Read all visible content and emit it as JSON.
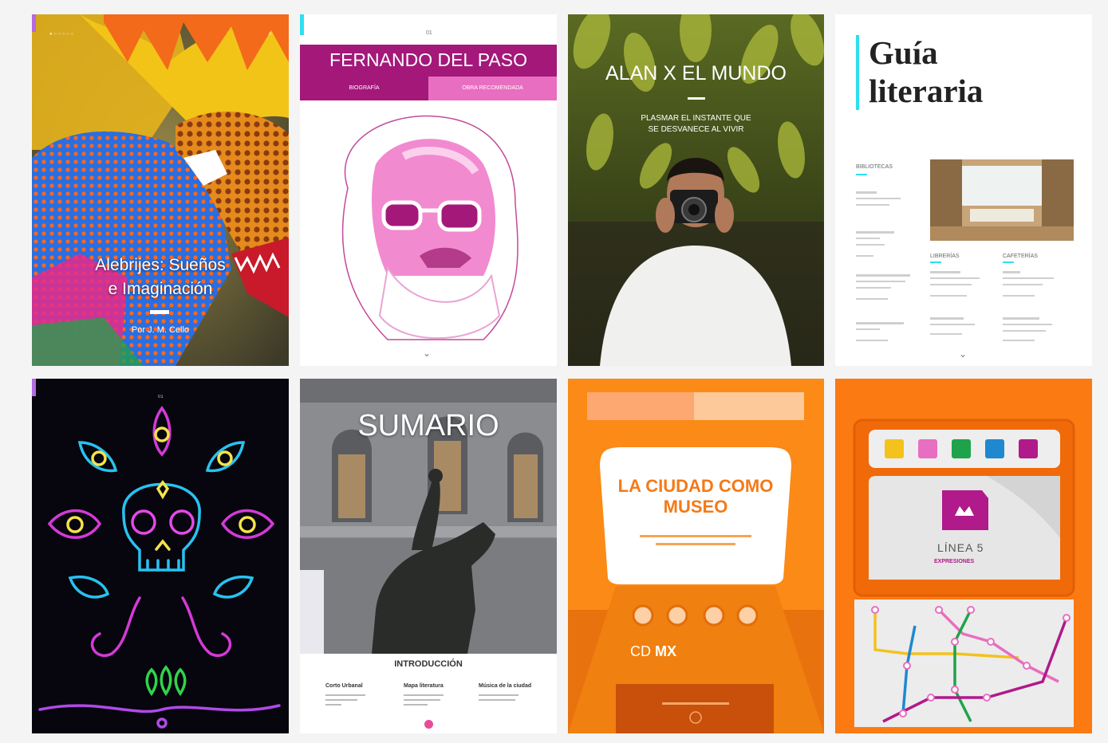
{
  "colors": {
    "page_bg": "#f4f4f4",
    "magenta": "#a4187a",
    "pink": "#e86ec1",
    "orange": "#fb8a16",
    "cyan": "#2de0f0"
  },
  "cards": {
    "alebrijes": {
      "title_line1": "Alebrijes: Sueños",
      "title_line2": "e Imaginación",
      "byline": "Por J. M. Cello"
    },
    "fernando": {
      "title": "FERNANDO DEL PASO",
      "tab_left": "BIOGRAFÍA",
      "tab_right": "OBRA RECOMENDADA",
      "page": "01",
      "icons": [
        "chevron-down-icon"
      ]
    },
    "alan": {
      "title": "ALAN X EL MUNDO",
      "subtitle_line1": "PLASMAR EL INSTANTE QUE",
      "subtitle_line2": "SE DESVANECE AL VIVIR"
    },
    "guia": {
      "title_line1": "Guía",
      "title_line2": "literaria",
      "sections": [
        "BIBLIOTECAS",
        "LIBRERÍAS",
        "CAFETERÍAS"
      ]
    },
    "neon": {
      "page": "01"
    },
    "sumario": {
      "title": "SUMARIO",
      "section": "INTRODUCCIÓN",
      "columns": [
        "Corto Urbanal",
        "Mapa literatura",
        "Música de la ciudad"
      ]
    },
    "ciudad": {
      "title_line1": "LA CIUDAD COMO",
      "title_line2": "MUSEO",
      "logo_cd": "CD",
      "logo_mx": "MX"
    },
    "metro": {
      "line_name": "LÍNEA 5",
      "line_sub": "EXPRESIONES"
    }
  }
}
